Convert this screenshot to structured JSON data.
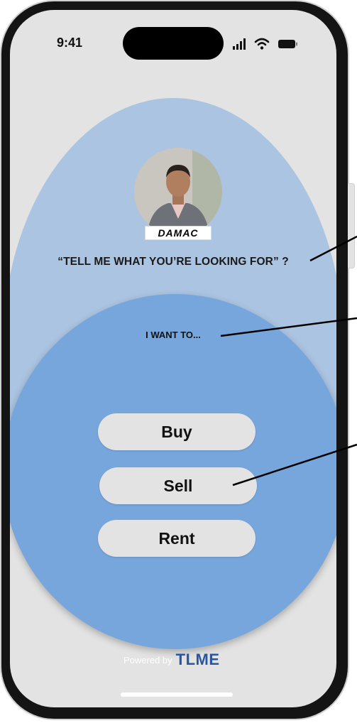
{
  "status_bar": {
    "time": "9:41",
    "icons": [
      "signal-icon",
      "wifi-icon",
      "battery-icon"
    ]
  },
  "agent": {
    "avatar": "agent-photo",
    "brand": "DAMAC"
  },
  "prompt": {
    "question": "“TELL ME WHAT YOU’RE LOOKING FOR” ?",
    "subheading": "I WANT TO..."
  },
  "options": {
    "buy": "Buy",
    "sell": "Sell",
    "rent": "Rent"
  },
  "footer": {
    "powered_by": "Powered by",
    "brand": "TLME"
  },
  "colors": {
    "screen_bg": "#e3e3e3",
    "outer_circle": "#abc4e1",
    "inner_circle": "#77a6dc",
    "button_bg": "#e3e3e3",
    "footer_brand": "#2a55a0"
  }
}
